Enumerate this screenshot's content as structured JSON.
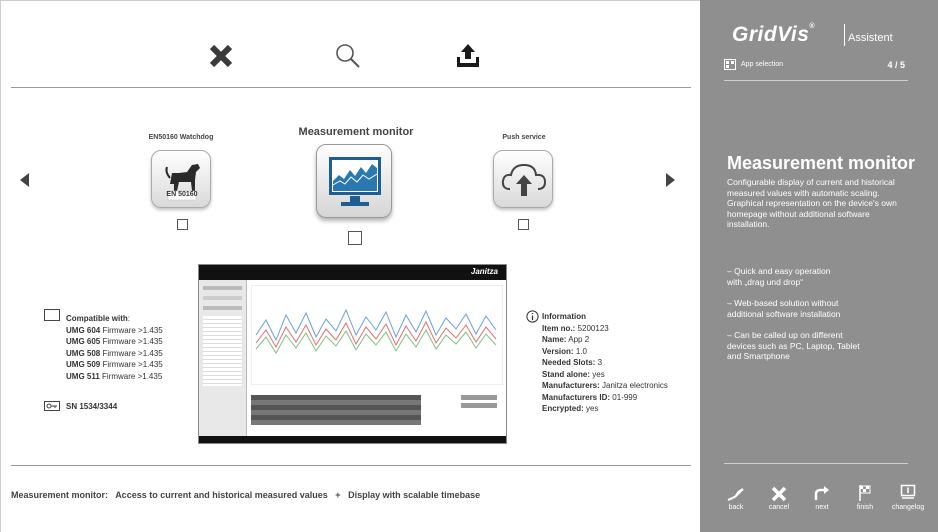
{
  "toolbar": {
    "close_icon": "close-icon",
    "search_icon": "search-icon",
    "upload_icon": "upload-icon"
  },
  "apps": [
    {
      "title": "EN50160 Watchdog",
      "badge": "EN 50160",
      "icon": "dog-icon"
    },
    {
      "title": "Measurement monitor",
      "icon": "monitor-chart-icon",
      "selected": true
    },
    {
      "title": "Push service",
      "icon": "cloud-upload-icon"
    }
  ],
  "compat": {
    "header": "Compatible with",
    "header_colon": ":",
    "items": [
      {
        "model": "UMG 604",
        "fw": "Firmware >1.435"
      },
      {
        "model": "UMG 605",
        "fw": "Firmware >1.435"
      },
      {
        "model": "UMG 508",
        "fw": "Firmware >1.435"
      },
      {
        "model": "UMG 509",
        "fw": "Firmware >1.435"
      },
      {
        "model": "UMG 511",
        "fw": "Firmware >1.435"
      }
    ],
    "sn": "SN 1534/3344"
  },
  "info": {
    "header": "Information",
    "rows": [
      {
        "label": "Item no.:",
        "value": "5200123"
      },
      {
        "label": "Name:",
        "value": "App 2"
      },
      {
        "label": "Version:",
        "value": "1.0"
      },
      {
        "label": "Needed Slots:",
        "value": "3"
      },
      {
        "label": "Stand alone:",
        "value": "yes"
      },
      {
        "label": "Manufacturers:",
        "value": "Janitza electronics"
      },
      {
        "label": "Manufacturers ID:",
        "value": "01-999"
      },
      {
        "label": "Encrypted:",
        "value": "yes"
      }
    ]
  },
  "preview": {
    "brand": "Janitza"
  },
  "bottom": {
    "name": "Measurement monitor:",
    "part1": "Access to current and historical measured values",
    "plus": "+",
    "part2": "Display with scalable timebase"
  },
  "sidebar": {
    "brand": "GridVis",
    "reg": "®",
    "sub": "Assistent",
    "app_selection": "App selection",
    "step": "4 / 5",
    "title": "Measurement monitor",
    "description": "Configurable display of current and historical measured values with automatic scaling. Graphical representation on the device's own homepage without additional software installation.",
    "bullets": [
      "– Quick and easy operation\n   with „drag und drop“",
      "– Web-based solution without\n   additional software installation",
      "– Can be called up on different\n   devices such as PC, Laptop, Tablet\n   and Smartphone"
    ],
    "buttons": [
      "back",
      "cancel",
      "next",
      "finish",
      "changelog"
    ]
  },
  "colors": {
    "sidebar_bg": "#8f8f8f",
    "accent_blue": "#1f5f8f"
  }
}
